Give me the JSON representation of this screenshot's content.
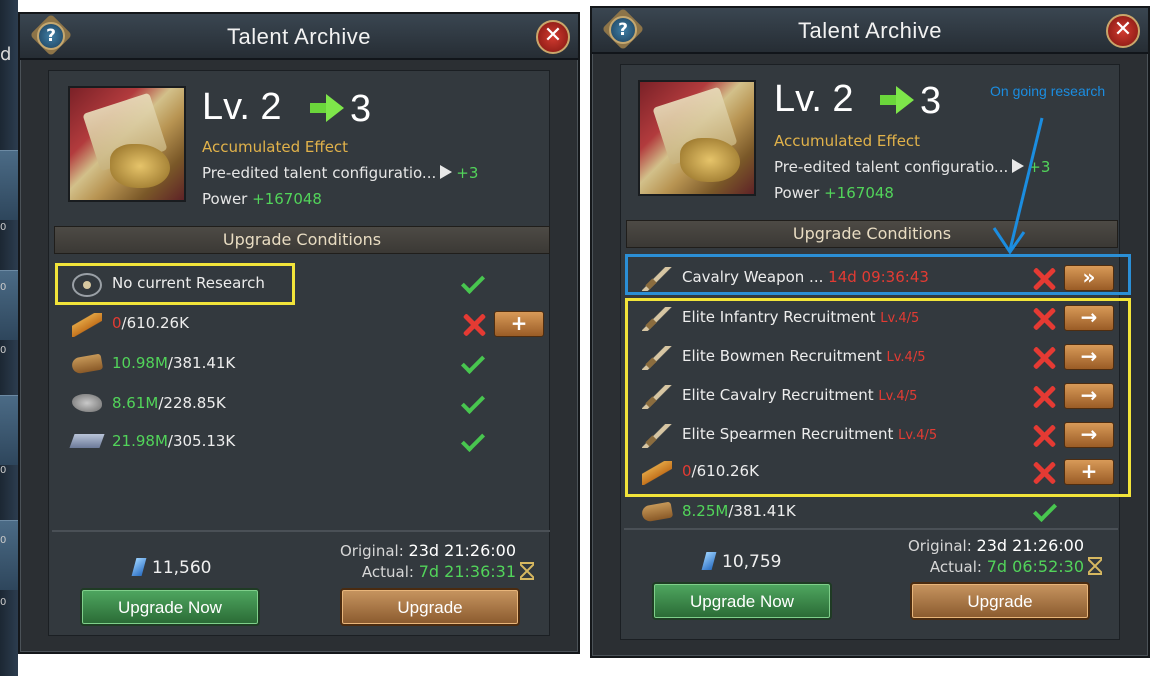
{
  "left_panel": {
    "title": "Talent Archive",
    "help_label": "?",
    "close_label": "✕",
    "level_current": "Lv. 2",
    "level_next": "3",
    "accumulated_effect": "Accumulated Effect",
    "effect_text": "Pre-edited talent configuratio...",
    "effect_bonus": "+3",
    "power_label": "Power",
    "power_value": "+167048",
    "upgrade_conditions": "Upgrade Conditions",
    "research": {
      "label": "No current Research"
    },
    "resources": [
      {
        "icon": "feather-icon",
        "have": "0",
        "need": "/610.26K",
        "have_color": "red",
        "ok": false,
        "action": "+"
      },
      {
        "icon": "wood-icon",
        "have": "10.98M",
        "need": "/381.41K",
        "have_color": "green",
        "ok": true
      },
      {
        "icon": "stone-icon",
        "have": "8.61M",
        "need": "/228.85K",
        "have_color": "green",
        "ok": true
      },
      {
        "icon": "iron-icon",
        "have": "21.98M",
        "need": "/305.13K",
        "have_color": "green",
        "ok": true
      }
    ],
    "gems": "11,560",
    "original_label": "Original:",
    "original_time": "23d 21:26:00",
    "actual_label": "Actual:",
    "actual_time": "7d 21:36:31",
    "upgrade_now": "Upgrade Now",
    "upgrade": "Upgrade"
  },
  "right_panel": {
    "title": "Talent Archive",
    "help_label": "?",
    "close_label": "✕",
    "level_current": "Lv. 2",
    "level_next": "3",
    "accumulated_effect": "Accumulated Effect",
    "effect_text": "Pre-edited talent configuratio...",
    "effect_bonus": "+3",
    "power_label": "Power",
    "power_value": "+167048",
    "upgrade_conditions": "Upgrade Conditions",
    "ongoing": {
      "label": "Cavalry Weapon ...",
      "timer": "14d 09:36:43",
      "action": "»"
    },
    "requirements": [
      {
        "label": "Elite Infantry Recruitment",
        "level": "Lv.4/5",
        "action": "→"
      },
      {
        "label": "Elite Bowmen Recruitment",
        "level": "Lv.4/5",
        "action": "→"
      },
      {
        "label": "Elite Cavalry Recruitment",
        "level": "Lv.4/5",
        "action": "→"
      },
      {
        "label": "Elite Spearmen Recruitment",
        "level": "Lv.4/5",
        "action": "→"
      }
    ],
    "feather": {
      "have": "0",
      "need": "/610.26K",
      "action": "+"
    },
    "wood": {
      "have": "8.25M",
      "need": "/381.41K"
    },
    "gems": "10,759",
    "original_label": "Original:",
    "original_time": "23d 21:26:00",
    "actual_label": "Actual:",
    "actual_time": "7d 06:52:30",
    "upgrade_now": "Upgrade Now",
    "upgrade": "Upgrade"
  },
  "annotation": "On going research",
  "edge": {
    "letter": "d",
    "nums": [
      "0",
      "0",
      "0",
      "0",
      "0",
      "0"
    ]
  },
  "colors": {
    "highlight_yellow": "#f2e43a",
    "highlight_blue": "#2b8fd6",
    "annotation": "#1b8de0"
  }
}
